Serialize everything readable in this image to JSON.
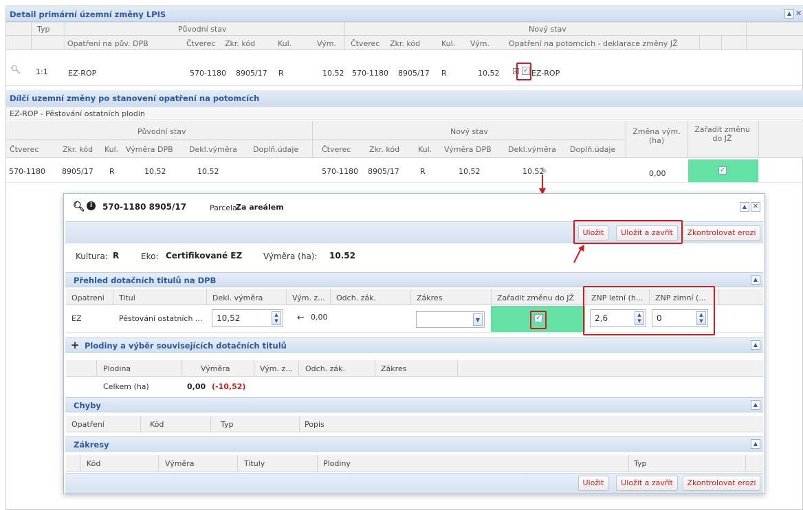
{
  "main": {
    "title": "Detail primární územní změny LPIS",
    "group_headers": {
      "typ": "Typ",
      "puvodni": "Původní stav",
      "novy": "Nový stav"
    },
    "columns": [
      "Opatření na pův. DPB",
      "Čtverec",
      "Zkr. kód",
      "Kul.",
      "Vým.",
      "Čtverec",
      "Zkr. kód",
      "Kul.",
      "Vým.",
      "Opatření na potomcích - deklarace změny JŽ"
    ],
    "row": {
      "typ": "1:1",
      "opatreni": "EZ-ROP",
      "ctverec": "570-1180",
      "kod": "8905/17",
      "kul": "R",
      "vym": "10,52",
      "n_ctverec": "570-1180",
      "n_kod": "8905/17",
      "n_kul": "R",
      "n_vym": "10,52",
      "n_opatreni": "EZ-ROP"
    }
  },
  "partial": {
    "title": "Dílčí uzemní změny po stanovení opatření na potomcích",
    "subtitle": "EZ-ROP - Pěstování ostatních plodin",
    "group_headers": {
      "puvodni": "Původní stav",
      "novy": "Nový stav",
      "zmena": "Změna vým. (ha)",
      "zaradit": "Zařadit změnu do JŽ"
    },
    "columns": [
      "Čtverec",
      "Zkr. kód",
      "Kul.",
      "Výměra DPB",
      "Dekl.výměra",
      "Doplň.údaje",
      "Čtverec",
      "Zkr. kód",
      "Kul.",
      "Výměra DPB",
      "Dekl.výměra",
      "Doplň.údaje"
    ],
    "row": {
      "ctverec": "570-1180",
      "kod": "8905/17",
      "kul": "R",
      "vymera": "10,52",
      "dekl": "10.52",
      "n_ctverec": "570-1180",
      "n_kod": "8905/17",
      "n_kul": "R",
      "n_vymera": "10,52",
      "n_dekl": "10.52",
      "zmena": "0,00"
    }
  },
  "dialog": {
    "title": "570-1180 8905/17",
    "parcela_label": "Parcela:",
    "parcela": "Za areálem",
    "buttons": {
      "save": "Uložit",
      "save_close": "Uložit a zavřít",
      "check": "Zkontrolovat erozi"
    },
    "info": {
      "kultura_label": "Kultura:",
      "kultura": "R",
      "eko_label": "Eko:",
      "eko": "Certifikované EZ",
      "vymera_label": "Výměra (ha):",
      "vymera": "10.52"
    },
    "dotace": {
      "title": "Přehled dotačních titulů na DPB",
      "columns": [
        "Opatreni",
        "Titul",
        "Dekl. výměra",
        "Vým. z...",
        "Odch. zák.",
        "Zákres",
        "Zařadit změnu do JŽ",
        "ZNP letní (h...",
        "ZNP zimní (..."
      ],
      "row": {
        "opatreni": "EZ",
        "titul": "Pěstování ostatních ...",
        "dekl": "10,52",
        "vym_z": "0,00",
        "znp_letni": "2,6",
        "znp_zimni": "0"
      }
    },
    "plodiny": {
      "title": "Plodiny a výběr souvisejících dotačních titulů",
      "columns": [
        "Plodina",
        "Výměra",
        "Vým. z...",
        "Odch. zák.",
        "Zákres"
      ],
      "total_label": "Celkem (ha)",
      "total": "0,00",
      "total_diff": "(-10,52)"
    },
    "chyby": {
      "title": "Chyby",
      "columns": [
        "Opatření",
        "Kód",
        "Typ",
        "Popis"
      ]
    },
    "zakresy": {
      "title": "Zákresy",
      "columns": [
        "Kód",
        "Výměra",
        "Tituly",
        "Plodiny",
        "Typ"
      ]
    }
  }
}
